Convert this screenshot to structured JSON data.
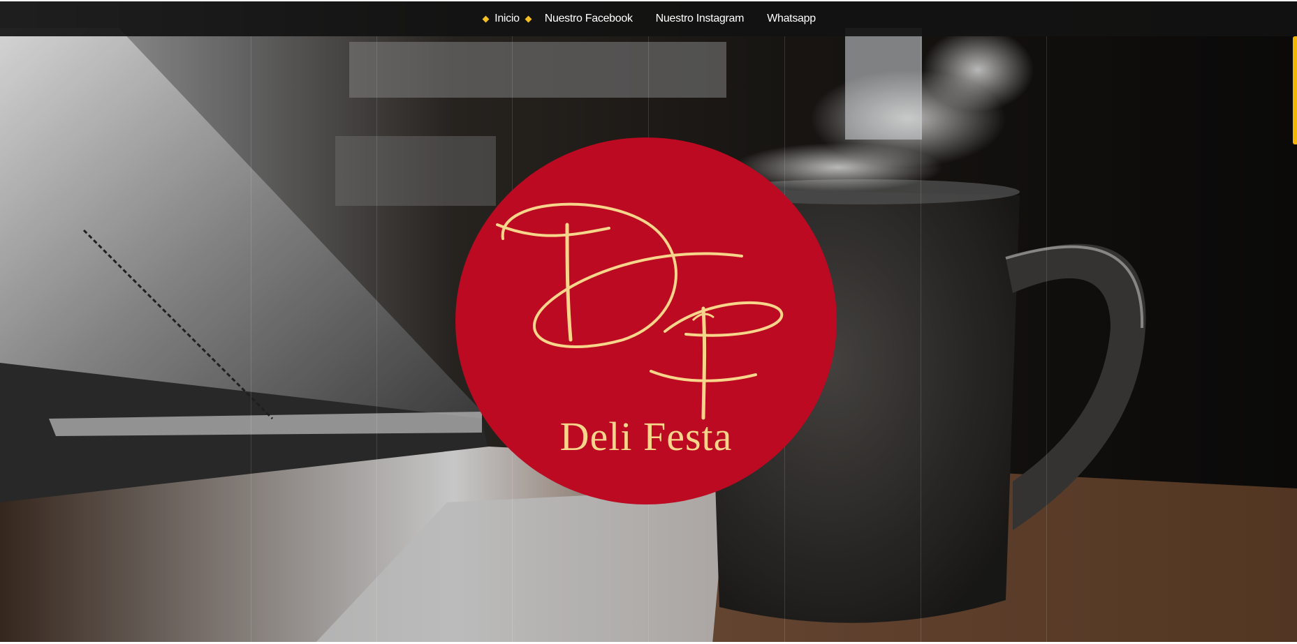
{
  "nav": {
    "items": [
      {
        "label": "Inicio",
        "active": true
      },
      {
        "label": "Nuestro Facebook",
        "active": false
      },
      {
        "label": "Nuestro Instagram",
        "active": false
      },
      {
        "label": "Whatsapp",
        "active": false
      }
    ]
  },
  "logo": {
    "monogram": "DF",
    "brand_name": "Deli Festa",
    "circle_color": "#bb0a22",
    "ink_color": "#f7d58a"
  },
  "colors": {
    "accent": "#f5c020",
    "topbar": "#121212"
  },
  "hero": {
    "background_icon": "coffee-mug-photo-icon"
  }
}
